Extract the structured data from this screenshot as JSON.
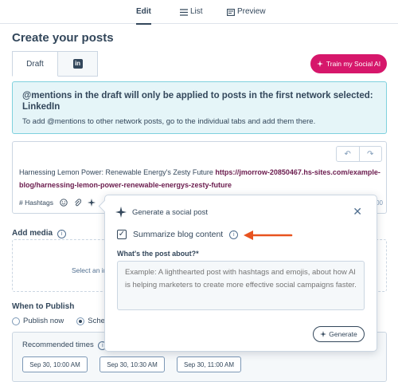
{
  "top_tabs": [
    {
      "label": "Edit",
      "icon": "",
      "active": true
    },
    {
      "label": "List",
      "icon": "list-icon",
      "active": false
    },
    {
      "label": "Preview",
      "icon": "preview-icon",
      "active": false
    }
  ],
  "page_title": "Create your posts",
  "network_tabs": {
    "draft_label": "Draft",
    "linkedin_icon": "linkedin-icon"
  },
  "train_button": "Train my Social AI",
  "alert": {
    "title": "@mentions in the draft will only be applied to posts in the first network selected: LinkedIn",
    "body": "To add @mentions to other network posts, go to the individual tabs and add them there."
  },
  "editor": {
    "text": "Harnessing Lemon Power: Renewable Energy's Zesty Future ",
    "link": "https://jmorrow-20850467.hs-sites.com/example-blog/harnessing-lemon-power-renewable-energys-zesty-future",
    "hashtags_label": "# Hashtags",
    "counter": "00"
  },
  "add_media": {
    "label": "Add media",
    "hint": "Select an im"
  },
  "publish": {
    "label": "When to Publish",
    "options": [
      "Publish now",
      "Sched"
    ],
    "recommended_label": "Recommended times",
    "times": [
      "Sep 30, 10:00 AM",
      "Sep 30, 10:30 AM",
      "Sep 30, 11:00 AM"
    ]
  },
  "popover": {
    "title": "Generate a social post",
    "checkbox_label": "Summarize blog content",
    "checkbox_checked": true,
    "question": "What's the post about?*",
    "placeholder": "Example: A lighthearted post with hashtags and emojis, about how AI is helping marketers to create more effective social campaigns faster.",
    "generate_label": "Generate"
  },
  "colors": {
    "accent_pink": "#d6176b",
    "alert_bg": "#e5f5f8",
    "arrow_orange": "#e8531f",
    "text": "#33475b"
  }
}
